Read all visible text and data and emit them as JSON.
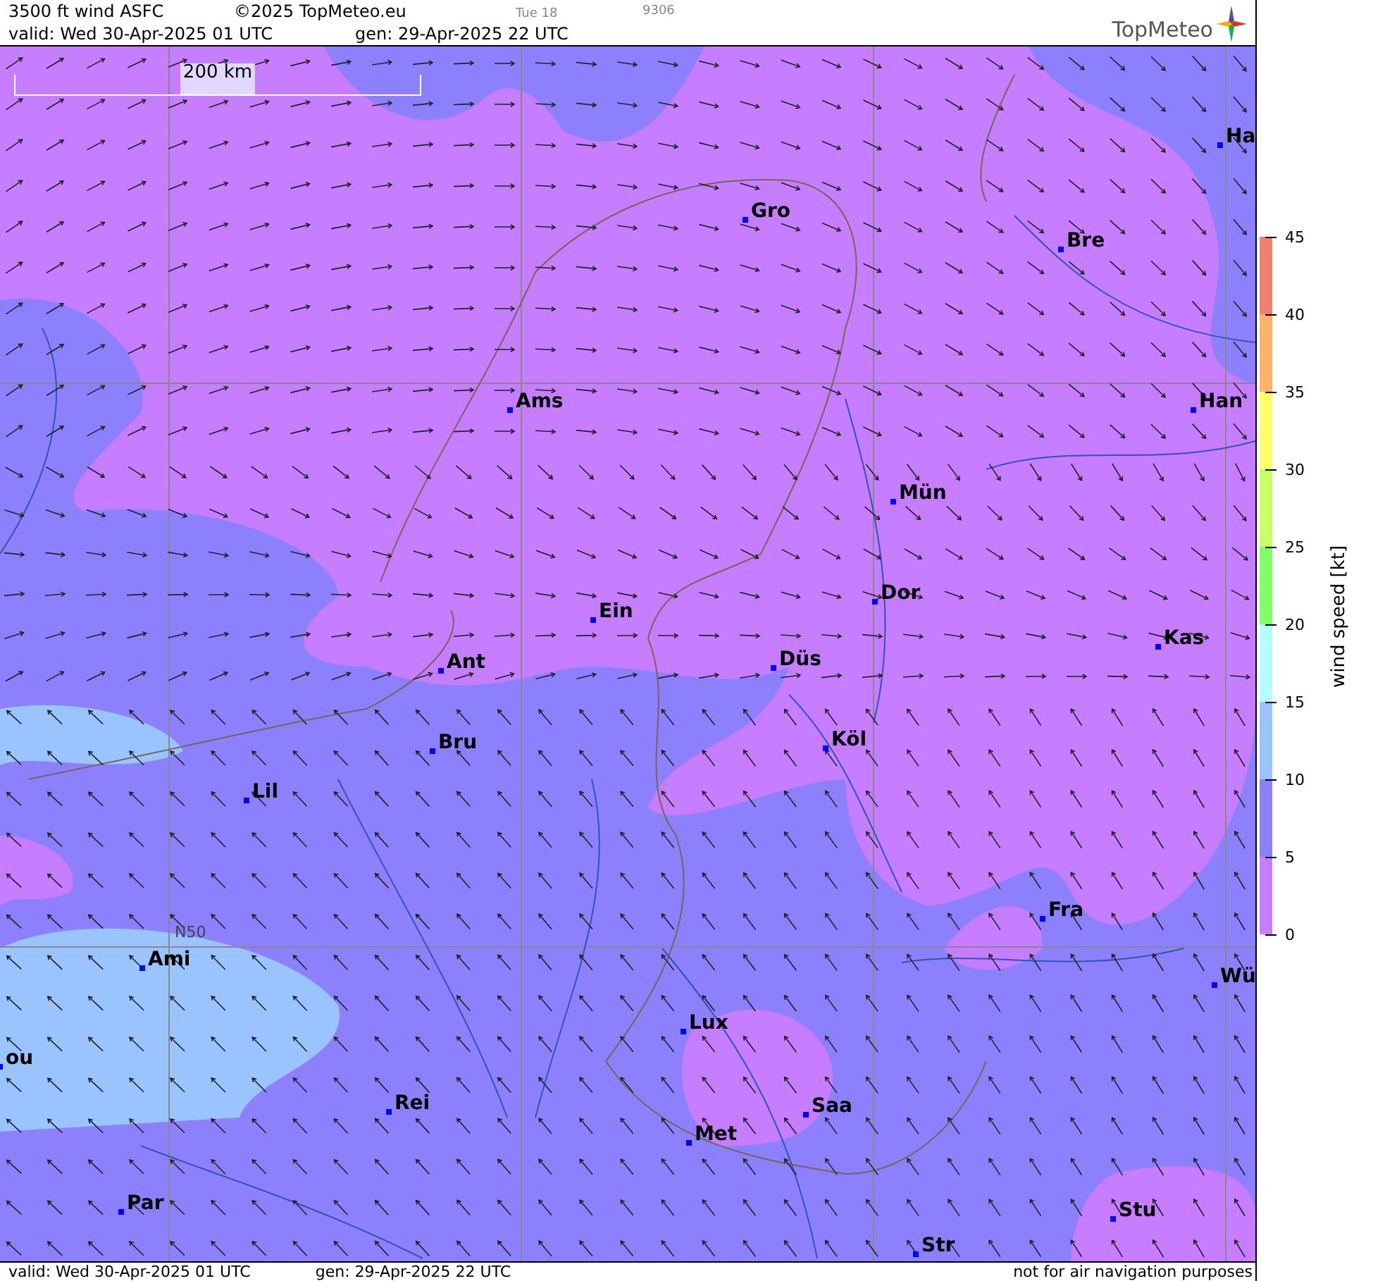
{
  "header": {
    "title": "3500 ft wind ASFC",
    "copyright": "©2025 TopMeteo.eu",
    "day": "Tue 18",
    "code": "9306",
    "valid": "valid:  Wed  30-Apr-2025  01  UTC",
    "generated": "gen: 29-Apr-2025 22 UTC",
    "logo": "TopMeteo"
  },
  "map": {
    "scale": "200 km",
    "grid_label": "N50",
    "cities": [
      {
        "name": "Ha"
      },
      {
        "name": "Gro"
      },
      {
        "name": "Bre"
      },
      {
        "name": "Ams"
      },
      {
        "name": "Han"
      },
      {
        "name": "Mün"
      },
      {
        "name": "Dor"
      },
      {
        "name": "Ein"
      },
      {
        "name": "Kas"
      },
      {
        "name": "Düs"
      },
      {
        "name": "Ant"
      },
      {
        "name": "Köl"
      },
      {
        "name": "Bru"
      },
      {
        "name": "Lil"
      },
      {
        "name": "Fra"
      },
      {
        "name": "Ami"
      },
      {
        "name": "Wü"
      },
      {
        "name": "Lux"
      },
      {
        "name": "ou"
      },
      {
        "name": "Rei"
      },
      {
        "name": "Saa"
      },
      {
        "name": "Met"
      },
      {
        "name": "Par"
      },
      {
        "name": "Stu"
      },
      {
        "name": "Str"
      }
    ]
  },
  "legend": {
    "title": "wind  speed  [kt]",
    "bands": [
      {
        "color": "#f08070"
      },
      {
        "color": "#ffb366"
      },
      {
        "color": "#ffff66"
      },
      {
        "color": "#c8ff66"
      },
      {
        "color": "#80ff66"
      },
      {
        "color": "#b3ffff"
      },
      {
        "color": "#99c4ff"
      },
      {
        "color": "#8c80ff"
      },
      {
        "color": "#c77dff"
      }
    ],
    "ticks": [
      "45",
      "40",
      "35",
      "30",
      "25",
      "20",
      "15",
      "10",
      "5",
      "0"
    ]
  },
  "footer": {
    "valid": "valid:  Wed  30-Apr-2025  01  UTC",
    "generated": "gen: 29-Apr-2025 22 UTC",
    "notice": "not for air navigation purposes"
  }
}
